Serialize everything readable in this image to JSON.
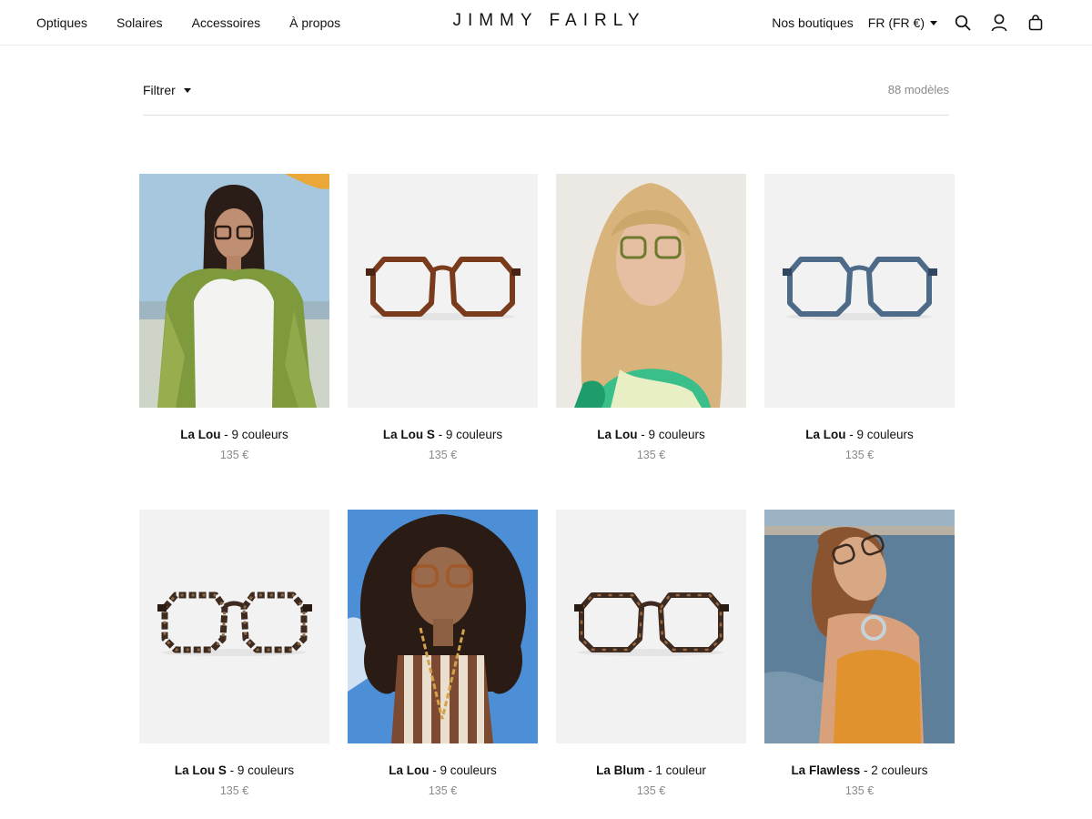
{
  "header": {
    "nav": [
      "Optiques",
      "Solaires",
      "Accessoires",
      "À propos"
    ],
    "logo": "JIMMY FAIRLY",
    "stores_label": "Nos boutiques",
    "currency": "FR (FR €)",
    "icons": [
      "search-icon",
      "account-icon",
      "bag-icon"
    ]
  },
  "filter": {
    "label": "Filtrer",
    "count": "88 modèles"
  },
  "products": [
    {
      "name": "La Lou",
      "variants": "- 9 couleurs",
      "price": "135 €",
      "image": "model-beach-green-scarf"
    },
    {
      "name": "La Lou S",
      "variants": "- 9 couleurs",
      "price": "135 €",
      "image": "frame-brown-tortoise"
    },
    {
      "name": "La Lou",
      "variants": "- 9 couleurs",
      "price": "135 €",
      "image": "model-blonde-tiedye"
    },
    {
      "name": "La Lou",
      "variants": "- 9 couleurs",
      "price": "135 €",
      "image": "frame-blue"
    },
    {
      "name": "La Lou S",
      "variants": "- 9 couleurs",
      "price": "135 €",
      "image": "frame-dark-tortoise"
    },
    {
      "name": "La Lou",
      "variants": "- 9 couleurs",
      "price": "135 €",
      "image": "model-curly-striped-top"
    },
    {
      "name": "La Blum",
      "variants": "- 1 couleur",
      "price": "135 €",
      "image": "frame-tortoise"
    },
    {
      "name": "La Flawless",
      "variants": "- 2 couleurs",
      "price": "135 €",
      "image": "model-sea-orange-top"
    }
  ],
  "colors": {
    "text": "#111111",
    "muted": "#8a8a8a",
    "product_bg": "#f2f2f2",
    "frame_brown": "#7a3b1c",
    "frame_blue": "#4d6a88",
    "frame_tortoise": "#3e2a1e"
  }
}
